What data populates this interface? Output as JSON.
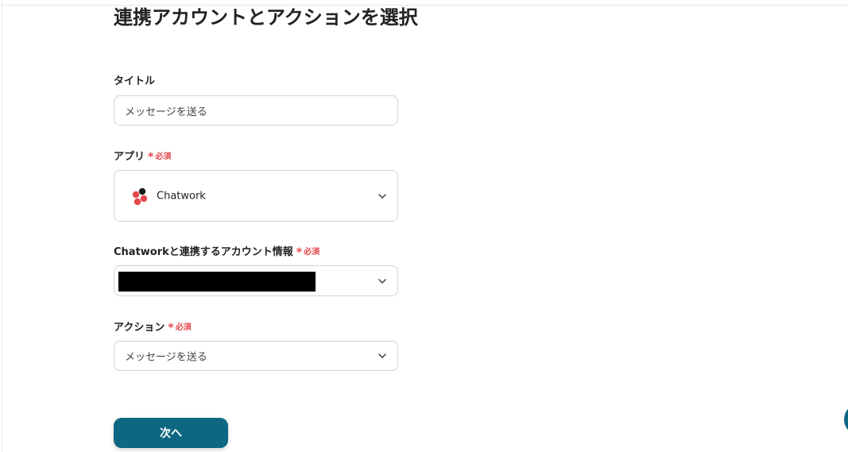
{
  "page": {
    "title": "連携アカウントとアクションを選択"
  },
  "form": {
    "title_field": {
      "label": "タイトル",
      "value": "メッセージを送る"
    },
    "app_field": {
      "label": "アプリ",
      "required_mark": "*",
      "required_text": "必須",
      "selected_app": "Chatwork",
      "logo_icon": "chatwork-logo-icon",
      "logo_colors": [
        "#1b1b1b",
        "#e5484d"
      ]
    },
    "account_field": {
      "label": "Chatworkと連携するアカウント情報",
      "required_mark": "*",
      "required_text": "必須",
      "value_redacted": true
    },
    "action_field": {
      "label": "アクション",
      "required_mark": "*",
      "required_text": "必須",
      "selected_action": "メッセージを送る"
    },
    "next_button": {
      "label": "次へ"
    }
  },
  "icons": {
    "chevron": "chevron-down-icon"
  },
  "colors": {
    "primary": "#0e6782",
    "required": "#e5484d",
    "border": "#d3d3d3",
    "text": "#222222"
  }
}
